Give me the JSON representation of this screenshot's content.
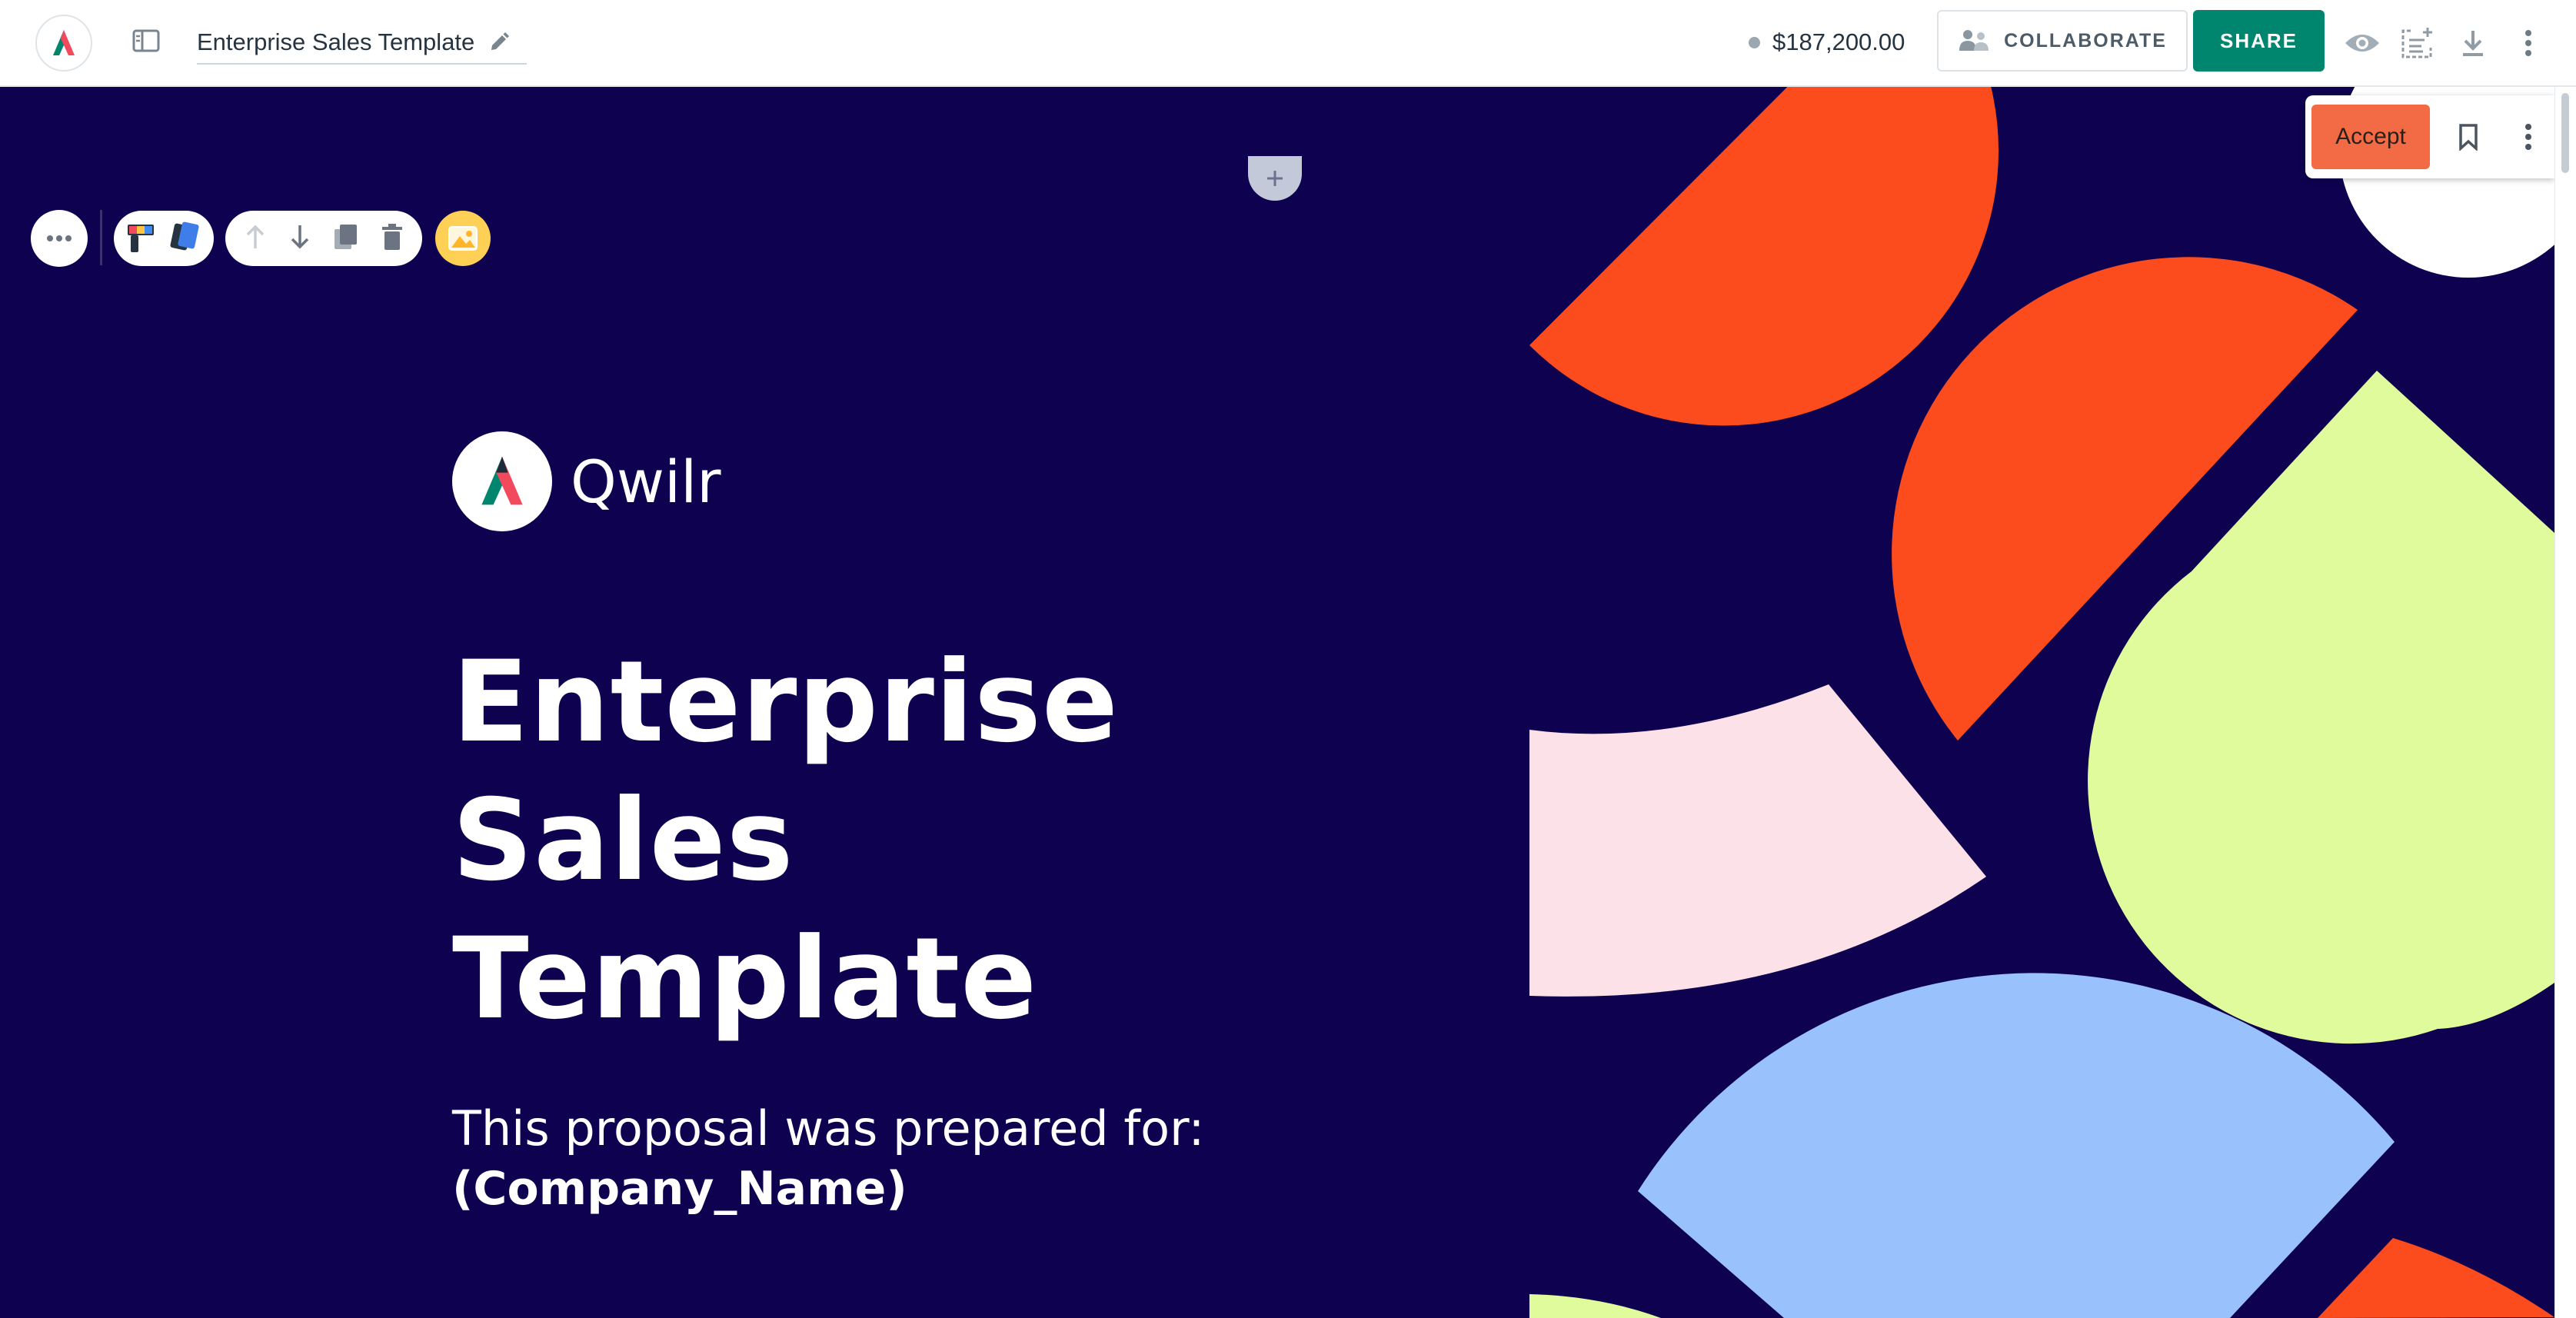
{
  "topbar": {
    "app_logo": "qwilr-logo",
    "panel_toggle_icon": "sidebar-panel-icon",
    "doc_title": "Enterprise Sales Template",
    "edit_icon": "pencil-icon",
    "total_value": "$187,200.00",
    "collaborate_label": "COLLABORATE",
    "share_label": "SHARE",
    "icons": [
      "eye-icon",
      "variables-icon",
      "download-icon",
      "more-vertical-icon"
    ]
  },
  "block_toolbar": {
    "items": [
      "more-horizontal-icon",
      "theme-colors-icon",
      "move-up-icon",
      "move-down-icon",
      "duplicate-icon",
      "delete-icon",
      "image-icon"
    ]
  },
  "hero": {
    "brand_name": "Qwilr",
    "title_lines": [
      "Enterprise",
      "Sales",
      "Template"
    ],
    "prepared_for": "This proposal was prepared for:",
    "company_name": "(Company_Name)"
  },
  "accept_panel": {
    "accept_label": "Accept",
    "icons": [
      "bookmark-icon",
      "more-vertical-icon"
    ]
  },
  "colors": {
    "background": "#0e0250",
    "share": "#00866e",
    "accept": "#f26b45",
    "shape_orange": "#fc4c1e",
    "shape_lime": "#e0fb9b",
    "shape_pink": "#fde1e8",
    "shape_blue": "#99c1fc"
  }
}
